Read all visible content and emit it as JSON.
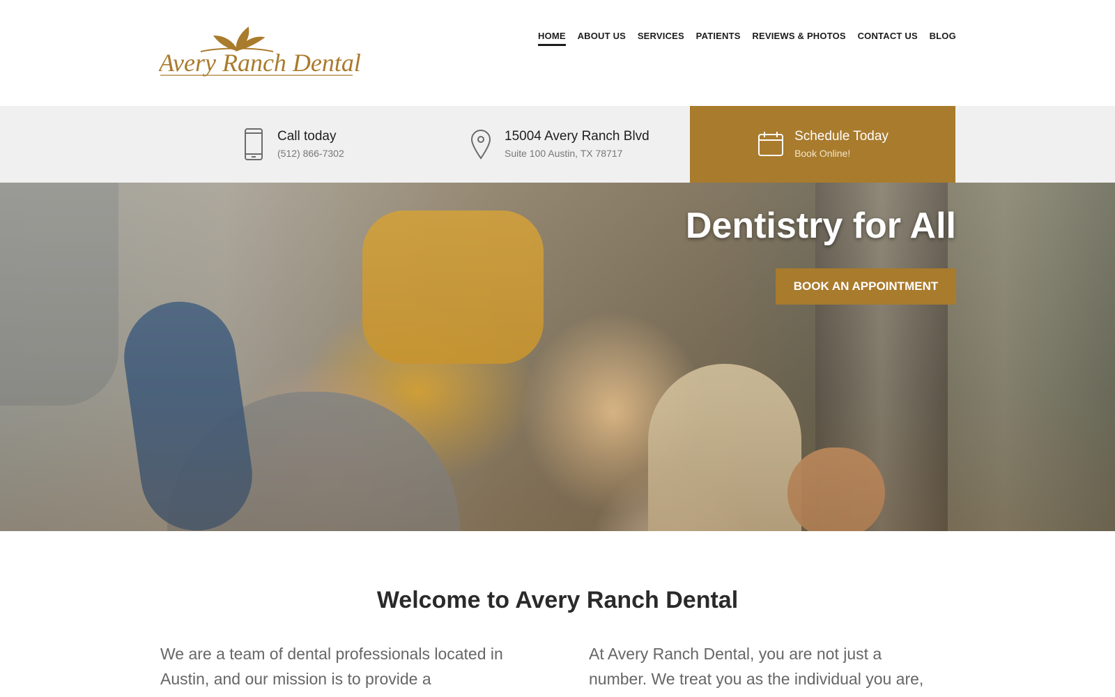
{
  "brand": {
    "name": "Avery Ranch Dental",
    "accent": "#a97b2d"
  },
  "nav": {
    "items": [
      {
        "label": "HOME",
        "active": true
      },
      {
        "label": "ABOUT US"
      },
      {
        "label": "SERVICES"
      },
      {
        "label": "PATIENTS"
      },
      {
        "label": "REVIEWS & PHOTOS"
      },
      {
        "label": "CONTACT US"
      },
      {
        "label": "BLOG"
      }
    ]
  },
  "infobar": {
    "call": {
      "icon": "phone-icon",
      "title": "Call today",
      "sub": "(512) 866-7302"
    },
    "address": {
      "icon": "map-pin-icon",
      "title": "15004 Avery Ranch Blvd",
      "sub": "Suite 100 Austin, TX 78717"
    },
    "schedule": {
      "icon": "calendar-icon",
      "title": "Schedule Today",
      "sub": "Book Online!"
    }
  },
  "hero": {
    "title": "Dentistry for All",
    "button_label": "BOOK AN APPOINTMENT"
  },
  "welcome": {
    "title": "Welcome to Avery Ranch Dental",
    "left_text": "We are a team of dental professionals located in Austin, and our mission is to provide a trustworthy",
    "right_text": "At Avery Ranch Dental, you are not just a number. We treat you as the individual you are, with customized"
  }
}
